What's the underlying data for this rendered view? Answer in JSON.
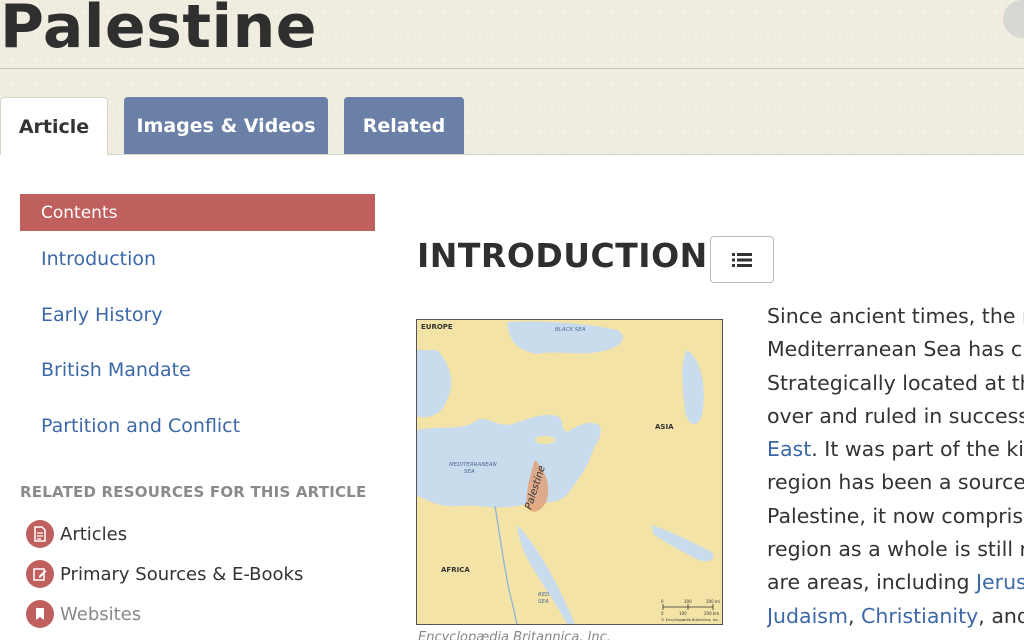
{
  "page": {
    "title": "Palestine"
  },
  "tabs": [
    {
      "label": "Article",
      "active": true
    },
    {
      "label": "Images & Videos",
      "active": false
    },
    {
      "label": "Related",
      "active": false
    }
  ],
  "sidebar": {
    "contents_label": "Contents",
    "toc": [
      "Introduction",
      "Early History",
      "British Mandate",
      "Partition and Conflict"
    ],
    "related_heading": "RELATED RESOURCES FOR THIS ARTICLE",
    "resources": [
      {
        "label": "Articles",
        "icon": "document-icon"
      },
      {
        "label": "Primary Sources & E-Books",
        "icon": "edit-icon"
      },
      {
        "label": "Websites",
        "icon": "bookmark-icon"
      }
    ]
  },
  "main": {
    "section_title": "INTRODUCTION",
    "toc_button_icon": "list-icon",
    "map": {
      "labels": {
        "europe": "EUROPE",
        "black_sea": "BLACK SEA",
        "asia": "ASIA",
        "mediterranean_line1": "MEDITERRANEAN",
        "mediterranean_line2": "SEA",
        "palestine": "Palestine",
        "africa": "AFRICA",
        "red_sea_line1": "RED",
        "red_sea_line2": "SEA",
        "scale_mi": "200 mi",
        "scale_km": "200 km",
        "scale_zero": "0",
        "scale_mid": "100",
        "copyright": "© Encyclopædia Britannica, Inc."
      }
    },
    "caption": "Encyclopædia Britannica, Inc.",
    "paragraph": {
      "line1": "Since ancient times, the r",
      "line2": "Mediterranean Sea has c",
      "line3": "Strategically located at th",
      "line4": "over and ruled in success",
      "line5_link": "East",
      "line5_rest": ". It was part of the kin",
      "line6": "region has been a source",
      "line7": "Palestine, it now compris",
      "line8": "region as a whole is still r",
      "line9_pre": "are areas, including ",
      "line9_link": "Jerus",
      "line10_link1": "Judaism",
      "line10_sep": ", ",
      "line10_link2": "Christianity",
      "line10_rest": ", and"
    }
  },
  "colors": {
    "header_bg": "#f1eee1",
    "tab_inactive": "#6a80a6",
    "accent_red": "#c0605e",
    "link_blue": "#3c68a8",
    "map_land": "#f4e3a6",
    "map_sea": "#c9dcee"
  }
}
